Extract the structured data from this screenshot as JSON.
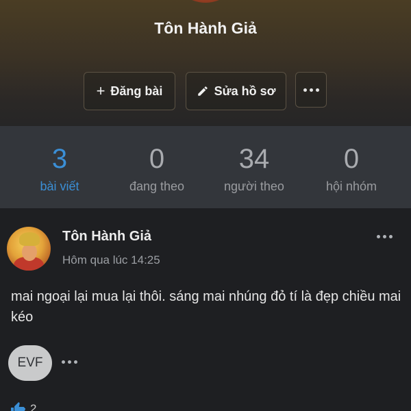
{
  "profile": {
    "name": "Tôn Hành Giả",
    "buttons": {
      "post_label": "Đăng bài",
      "edit_label": "Sửa hồ sơ"
    }
  },
  "stats": [
    {
      "value": "3",
      "label": "bài viết",
      "active": true
    },
    {
      "value": "0",
      "label": "đang theo",
      "active": false
    },
    {
      "value": "34",
      "label": "người theo",
      "active": false
    },
    {
      "value": "0",
      "label": "hội nhóm",
      "active": false
    }
  ],
  "post": {
    "author": "Tôn Hành Giả",
    "time": "Hôm qua lúc 14:25",
    "content": "mai ngoại lại mua lại thôi. sáng mai nhúng đỏ tí là đẹp chiều mai kéo",
    "tagged_initials": "EVF",
    "like_count": "2"
  },
  "colors": {
    "accent": "#3b8fd6",
    "background": "#1e1f22",
    "stats_bg": "#33363b",
    "header_top": "#4a3d24"
  },
  "icons": {
    "post": "plus-icon",
    "edit": "pencil-icon",
    "more": "more-dots-icon",
    "like": "thumbs-up-icon"
  }
}
